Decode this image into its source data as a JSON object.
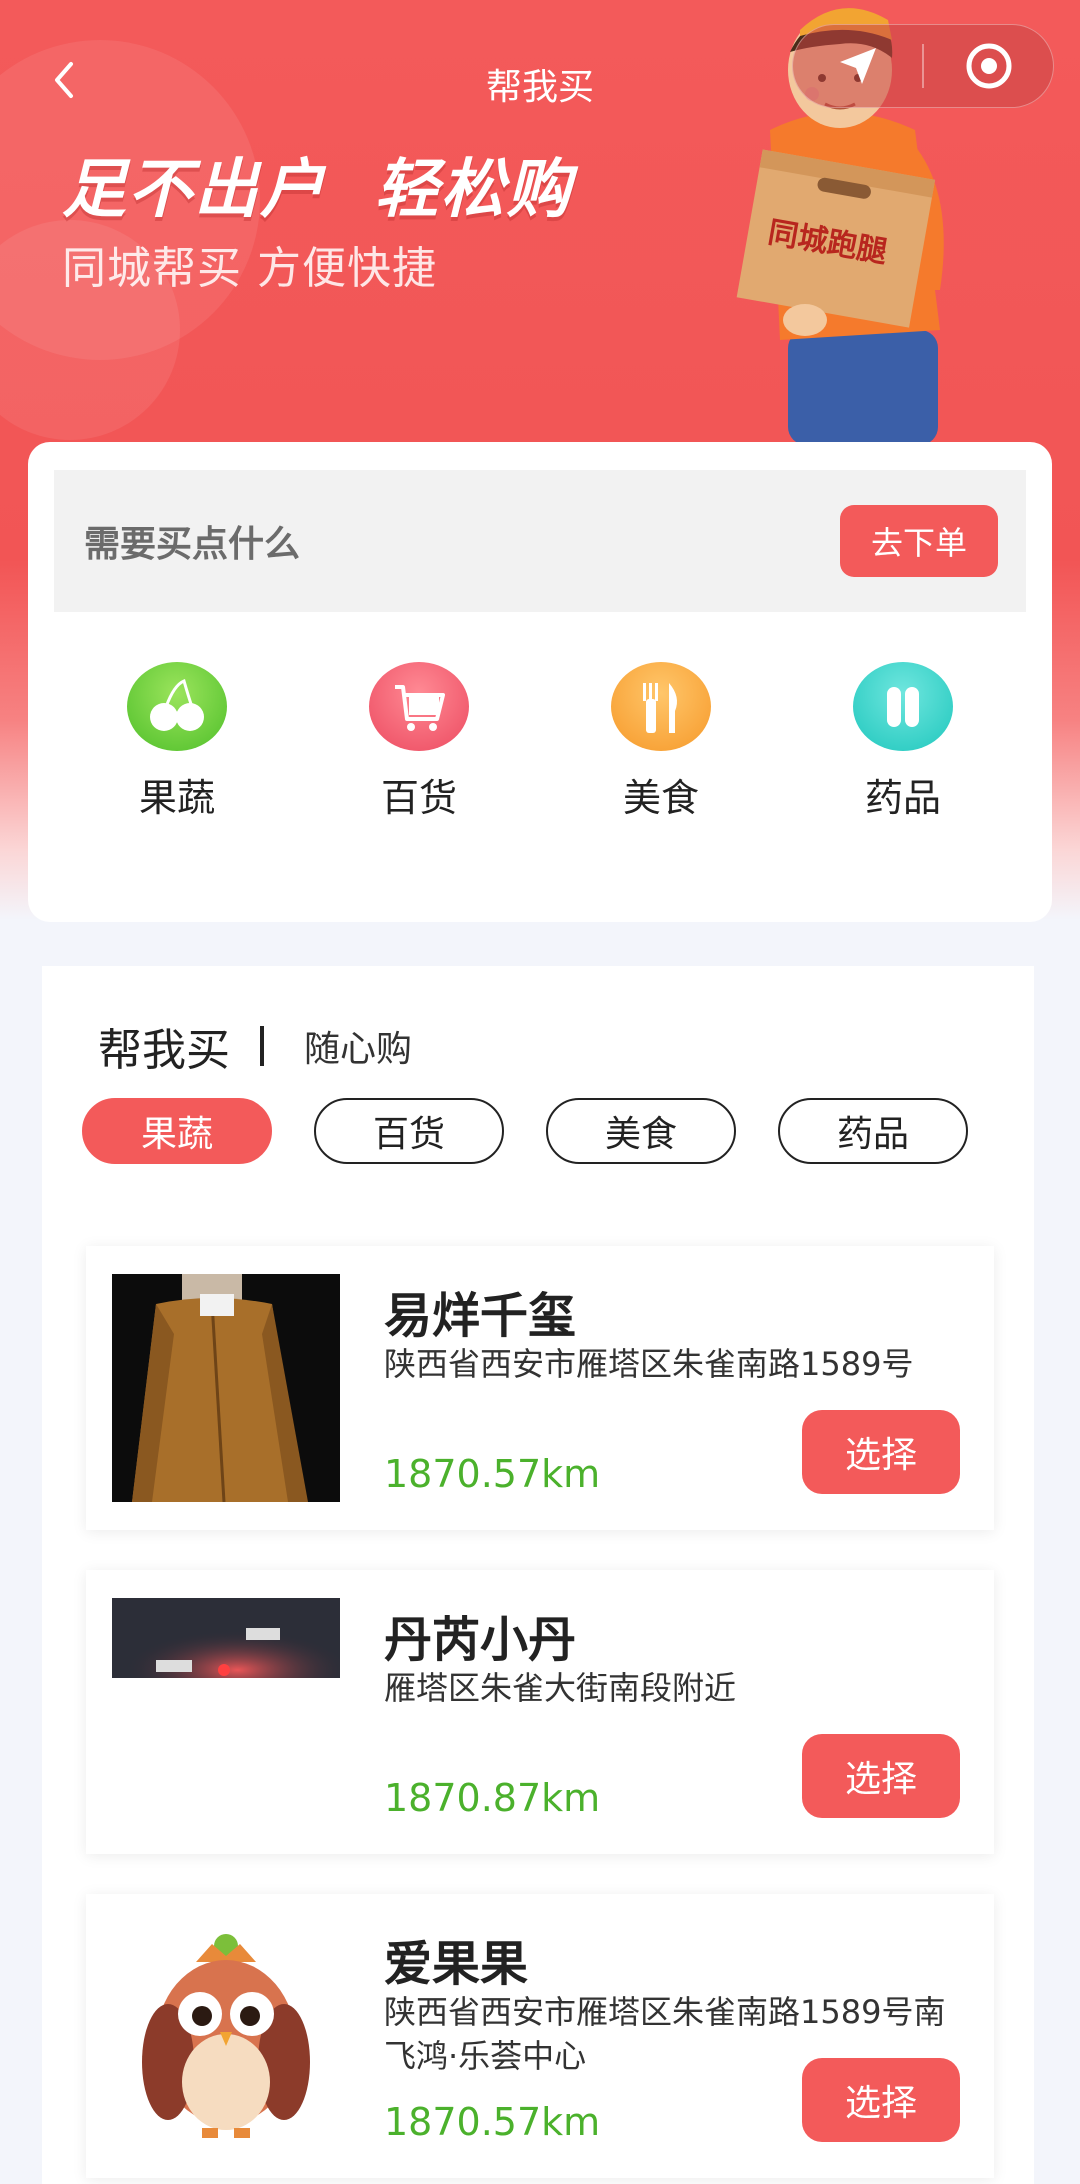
{
  "nav": {
    "title": "帮我买",
    "back_icon": "chevron-left-icon",
    "menu_icon": "navigation-arrow-icon",
    "close_icon": "target-circle-icon"
  },
  "hero": {
    "slogan": "足不出户  轻松购",
    "subslogan": "同城帮买 方便快捷",
    "box_text": "同城跑腿"
  },
  "order": {
    "prompt": "需要买点什么",
    "button_label": "去下单"
  },
  "categories": [
    {
      "label": "果蔬",
      "icon": "cherry-icon",
      "color": "#5fcf3a"
    },
    {
      "label": "百货",
      "icon": "shopping-cart-icon",
      "color": "#f2586a"
    },
    {
      "label": "美食",
      "icon": "fork-knife-icon",
      "color": "#f9a52c"
    },
    {
      "label": "药品",
      "icon": "pill-icon",
      "color": "#2fd2c7"
    }
  ],
  "shops_section": {
    "tab_main": "帮我买",
    "tab_alt": "随心购",
    "chips": [
      {
        "label": "果蔬",
        "active": true
      },
      {
        "label": "百货",
        "active": false
      },
      {
        "label": "美食",
        "active": false
      },
      {
        "label": "药品",
        "active": false
      }
    ]
  },
  "shops": [
    {
      "name": "易烊千玺",
      "address": "陕西省西安市雁塔区朱雀南路1589号",
      "distance": "1870.57km",
      "button": "选择",
      "thumb": "jacket-photo"
    },
    {
      "name": "丹芮小丹",
      "address": "雁塔区朱雀大街南段附近",
      "distance": "1870.87km",
      "button": "选择",
      "thumb": "night-photo"
    },
    {
      "name": "爱果果",
      "address": "陕西省西安市雁塔区朱雀南路1589号南飞鸿·乐荟中心",
      "distance": "1870.57km",
      "button": "选择",
      "thumb": "owl-logo"
    }
  ],
  "colors": {
    "accent": "#f35a5a",
    "distance": "#4bb12c"
  }
}
